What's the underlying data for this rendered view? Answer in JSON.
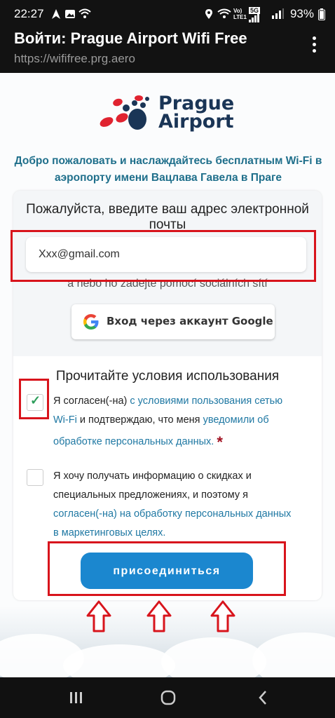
{
  "status_bar": {
    "time": "22:27",
    "battery": "93%",
    "icons_left": [
      "navigation-icon",
      "gallery-icon",
      "wifi-icon"
    ],
    "icons_right": [
      "location-icon",
      "wifi-icon",
      "volte-icon",
      "5g-signal-icon",
      "signal-icon",
      "battery-icon"
    ]
  },
  "header": {
    "title": "Войти: Prague Airport Wifi Free",
    "url": "https://wififree.prg.aero"
  },
  "logo": {
    "line1": "Prague",
    "line2": "Airport"
  },
  "welcome": "Добро пожаловать и наслаждайтесь бесплатным Wi-Fi в аэропорту имени Вацлава Гавела в Праге",
  "email": {
    "prompt": "Пожалуйста, введите ваш адрес электронной почты",
    "value": "Xxx@gmail.com",
    "social_text": "a nebo ho zadejte pomocí sociálních sítí"
  },
  "google_button": {
    "label": "Вход через аккаунт Google"
  },
  "terms": {
    "title": "Прочитайте условия использования",
    "consent1": {
      "checked": true,
      "text_before": "Я согласен(-на) ",
      "link1": "с условиями пользования сетью Wi-Fi",
      "text_middle": " и подтверждаю, что меня ",
      "link2": "уведомили об обработке персональных данных.",
      "required_mark": "*"
    },
    "consent2": {
      "checked": false,
      "text_before": "Я хочу получать информацию о скидках и специальных предложениях, и поэтому я ",
      "link": "согласен(-на) на обработку персональных данных в маркетинговых целях."
    }
  },
  "connect_button": {
    "label": "присоединиться"
  },
  "colors": {
    "accent": "#1b87cf",
    "link": "#1f78a3",
    "annotation": "#d8141c",
    "check": "#2e9e5b"
  },
  "nav_bar": {
    "buttons": [
      "recent-apps-icon",
      "home-icon",
      "back-icon"
    ]
  }
}
